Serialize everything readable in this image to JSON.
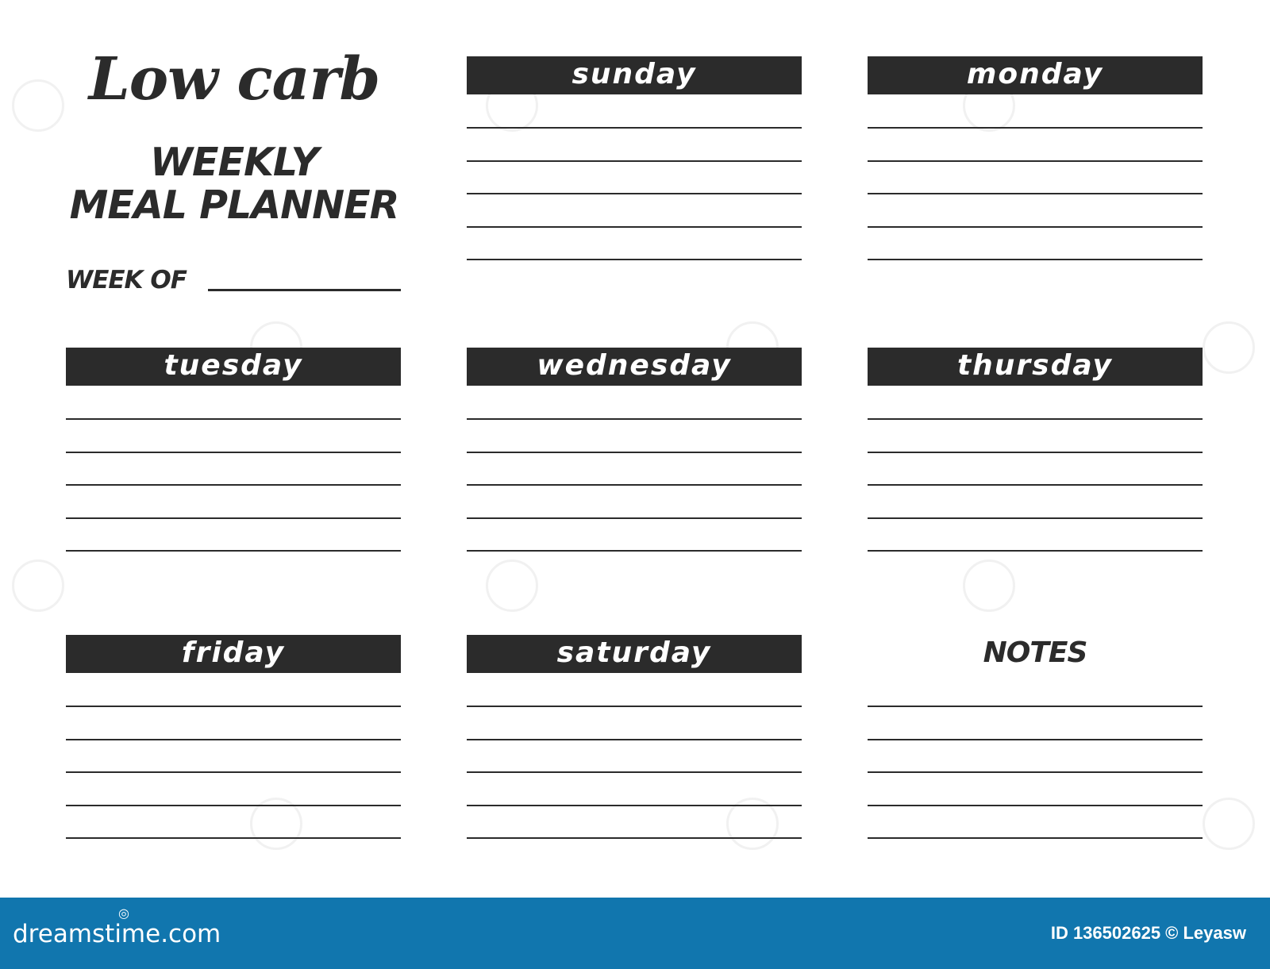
{
  "header": {
    "script_title": "Low carb",
    "title_line1": "WEEKLY",
    "title_line2": "MEAL PLANNER",
    "week_of_label": "WEEK OF",
    "week_of_value": ""
  },
  "days": [
    {
      "label": "sunday"
    },
    {
      "label": "monday"
    },
    {
      "label": "tuesday"
    },
    {
      "label": "wednesday"
    },
    {
      "label": "thursday"
    },
    {
      "label": "friday"
    },
    {
      "label": "saturday"
    }
  ],
  "notes": {
    "label": "NOTES"
  },
  "lines_per_section": 5,
  "colors": {
    "ink": "#2b2b2b",
    "bar_text": "#ffffff",
    "footer_bg": "#1176ae"
  },
  "footer": {
    "brand": "dreamstime.com",
    "brand_icon": "spiral-icon",
    "image_id": "ID 136502625 © Leyasw"
  }
}
